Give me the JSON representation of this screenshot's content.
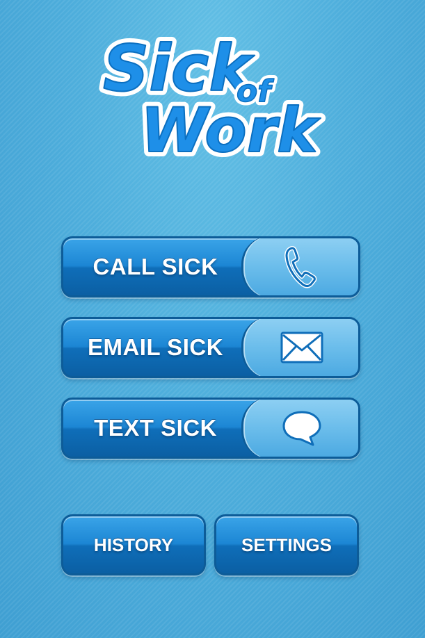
{
  "logo": {
    "line1": "Sick",
    "line2": "of",
    "line3": "Work",
    "colors": {
      "fill": "#1e8fe8",
      "outline": "#ffffff",
      "shadow": "#0b5fa3"
    }
  },
  "actions": [
    {
      "label": "CALL SICK",
      "icon": "phone-icon"
    },
    {
      "label": "EMAIL SICK",
      "icon": "envelope-icon"
    },
    {
      "label": "TEXT SICK",
      "icon": "speech-bubble-icon"
    }
  ],
  "bottom": {
    "history_label": "HISTORY",
    "settings_label": "SETTINGS"
  },
  "colors": {
    "background": "#4aaad9",
    "button_blue": "#1c86d4",
    "button_border": "#0d5c98",
    "icon_panel": "#6bbdeb",
    "text": "#ffffff"
  }
}
